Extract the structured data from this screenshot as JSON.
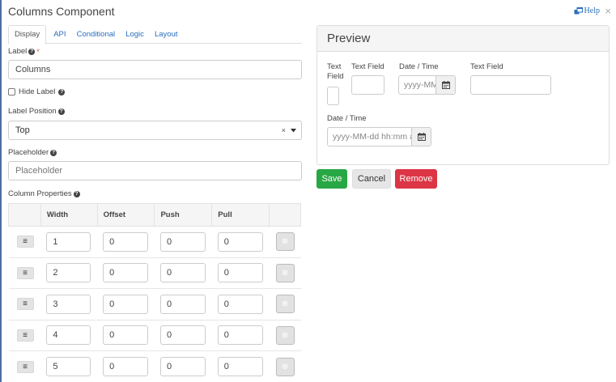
{
  "modal": {
    "title": "Columns Component",
    "close_glyph": "×",
    "help_label": "Help",
    "help_icon": "external-link-icon"
  },
  "tabs": [
    {
      "label": "Display",
      "active": true
    },
    {
      "label": "API"
    },
    {
      "label": "Conditional"
    },
    {
      "label": "Logic"
    },
    {
      "label": "Layout"
    }
  ],
  "form": {
    "label_field": {
      "label": "Label",
      "required_mark": "*",
      "value": "Columns"
    },
    "hide_label": {
      "label": "Hide Label",
      "checked": false
    },
    "label_position": {
      "label": "Label Position",
      "value": "Top",
      "clear_glyph": "×"
    },
    "placeholder_field": {
      "label": "Placeholder",
      "placeholder": "Placeholder"
    },
    "column_properties": {
      "label": "Column Properties",
      "headers": [
        "",
        "Width",
        "Offset",
        "Push",
        "Pull",
        ""
      ],
      "rows": [
        {
          "width": "1",
          "offset": "0",
          "push": "0",
          "pull": "0"
        },
        {
          "width": "2",
          "offset": "0",
          "push": "0",
          "pull": "0"
        },
        {
          "width": "3",
          "offset": "0",
          "push": "0",
          "pull": "0"
        },
        {
          "width": "4",
          "offset": "0",
          "push": "0",
          "pull": "0"
        },
        {
          "width": "5",
          "offset": "0",
          "push": "0",
          "pull": "0"
        }
      ],
      "drag_glyph": "≡",
      "remove_glyph": "⊗"
    }
  },
  "preview": {
    "title": "Preview",
    "text_field_1_label_a": "Text",
    "text_field_1_label_b": "Field",
    "text_field_2_label": "Text Field",
    "datetime_1_label": "Date / Time",
    "datetime_1_placeholder": "yyyy-MM-dd hh:mm a",
    "text_field_3_label": "Text Field",
    "datetime_2_label": "Date / Time",
    "datetime_2_placeholder": "yyyy-MM-dd hh:mm a"
  },
  "actions": {
    "save": "Save",
    "cancel": "Cancel",
    "remove": "Remove"
  },
  "colors": {
    "link": "#2a6ebb",
    "save": "#28a745",
    "remove": "#dc3545"
  }
}
